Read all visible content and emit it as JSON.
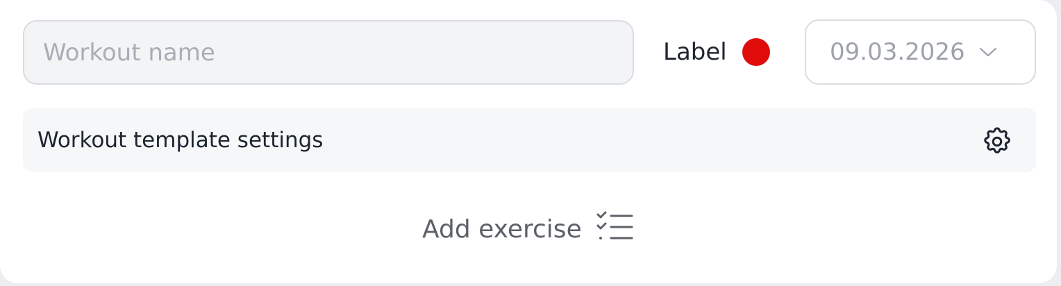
{
  "workout": {
    "name_value": "",
    "name_placeholder": "Workout name",
    "label_text": "Label",
    "label_color": "#e00b0b",
    "date_value": "09.03.2026"
  },
  "settings": {
    "label": "Workout template settings",
    "icon": "gear-icon"
  },
  "actions": {
    "add_exercise_label": "Add exercise",
    "add_exercise_icon": "checklist-icon"
  },
  "colors": {
    "card_background": "#ffffff",
    "input_background": "#f3f4f6",
    "settings_background": "#f5f7f9",
    "border": "#d9dce1",
    "placeholder": "#a9adb5",
    "text_dark": "#1f2530",
    "text_muted": "#5c6068"
  }
}
